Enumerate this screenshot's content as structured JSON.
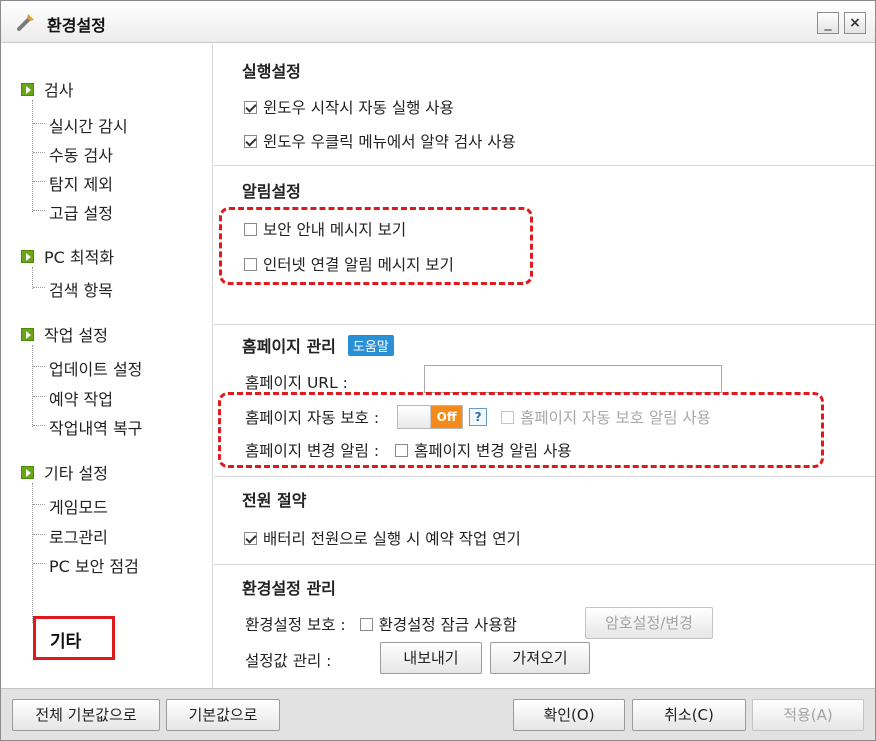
{
  "window": {
    "title": "환경설정",
    "minimize_label": "_",
    "close_label": "×"
  },
  "sidebar": {
    "groups": [
      {
        "label": "검사",
        "items": [
          "실시간 감시",
          "수동 검사",
          "탐지 제외",
          "고급 설정"
        ]
      },
      {
        "label": "PC 최적화",
        "items": [
          "검색 항목"
        ]
      },
      {
        "label": "작업 설정",
        "items": [
          "업데이트 설정",
          "예약 작업",
          "작업내역 복구"
        ]
      },
      {
        "label": "기타 설정",
        "items": [
          "게임모드",
          "로그관리",
          "PC 보안 점검",
          "기타"
        ]
      }
    ],
    "selected": "기타"
  },
  "sections": {
    "run": {
      "title": "실행설정",
      "opt1": "윈도우 시작시 자동 실행 사용",
      "opt2": "윈도우 우클릭 메뉴에서 알약 검사 사용"
    },
    "alert": {
      "title": "알림설정",
      "opt1": "보안 안내 메시지 보기",
      "opt2": "인터넷 연결 알림 메시지 보기"
    },
    "homepage": {
      "title": "홈페이지 관리",
      "help": "도움말",
      "url_label": "홈페이지 URL :",
      "url_value": "",
      "auto_label": "홈페이지 자동 보호 :",
      "toggle": "Off",
      "help_icon": "?",
      "auto_alert": "홈페이지 자동 보호 알림 사용",
      "change_label": "홈페이지 변경 알림 :",
      "change_opt": "홈페이지 변경 알림 사용"
    },
    "power": {
      "title": "전원 절약",
      "opt1": "배터리 전원으로 실행 시 예약 작업 연기"
    },
    "config": {
      "title": "환경설정 관리",
      "protect_label": "환경설정 보호 :",
      "lock_opt": "환경설정 잠금 사용함",
      "password_btn": "암호설정/변경",
      "value_label": "설정값 관리 :",
      "export_btn": "내보내기",
      "import_btn": "가져오기"
    }
  },
  "footer": {
    "reset_all": "전체 기본값으로",
    "reset": "기본값으로",
    "ok": "확인(O)",
    "cancel": "취소(C)",
    "apply": "적용(A)"
  },
  "colors": {
    "accent_green": "#6aa515",
    "highlight_red": "#e0191c",
    "toggle_orange": "#f48a1a",
    "help_blue": "#2b8fd6"
  }
}
